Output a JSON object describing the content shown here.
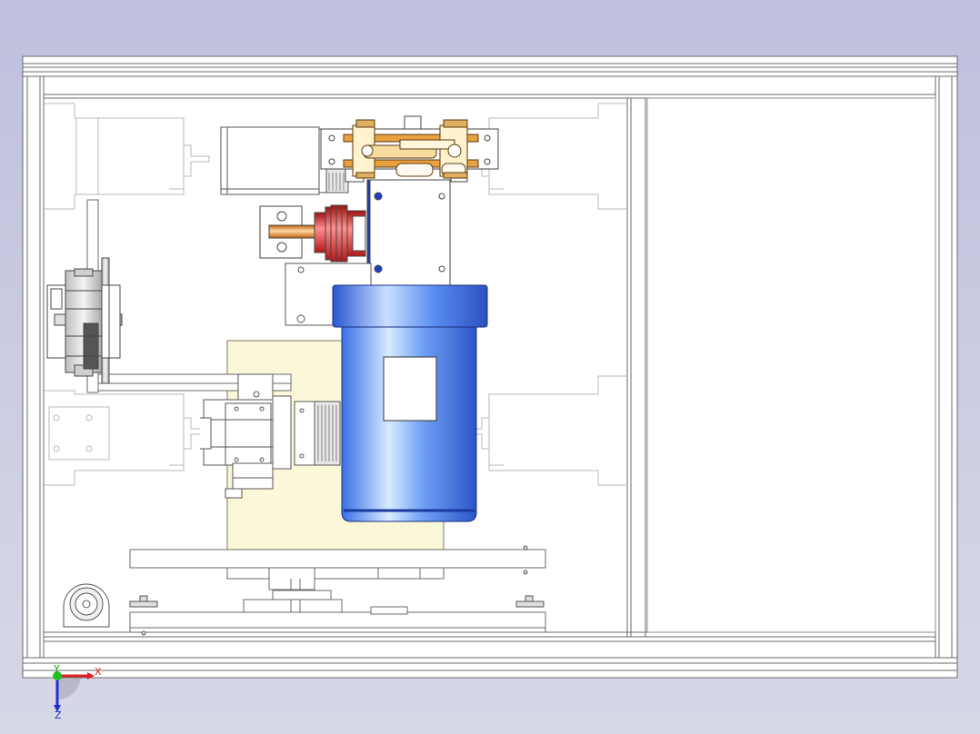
{
  "viewport": {
    "background_top": "#bfc0de",
    "background_bottom": "#d7d8e6",
    "frame_fill": "#ffffff",
    "line_color": "#6a6a6a"
  },
  "triad": {
    "x_label": "X",
    "y_label": "Y",
    "z_label": "Z",
    "x_color": "#e02020",
    "y_color": "#20c020",
    "z_color": "#2030d0"
  },
  "parts": {
    "motor": {
      "name": "blue-motor",
      "color": "#3a6fe6",
      "highlight": "#d8ecff"
    },
    "coupling": {
      "name": "red-bellows-coupling",
      "color": "#d83030"
    },
    "linkage": {
      "name": "orange-linkage",
      "color": "#e8a040"
    },
    "base_plate": {
      "name": "yellow-base-plate",
      "color": "#fbf8da"
    }
  }
}
